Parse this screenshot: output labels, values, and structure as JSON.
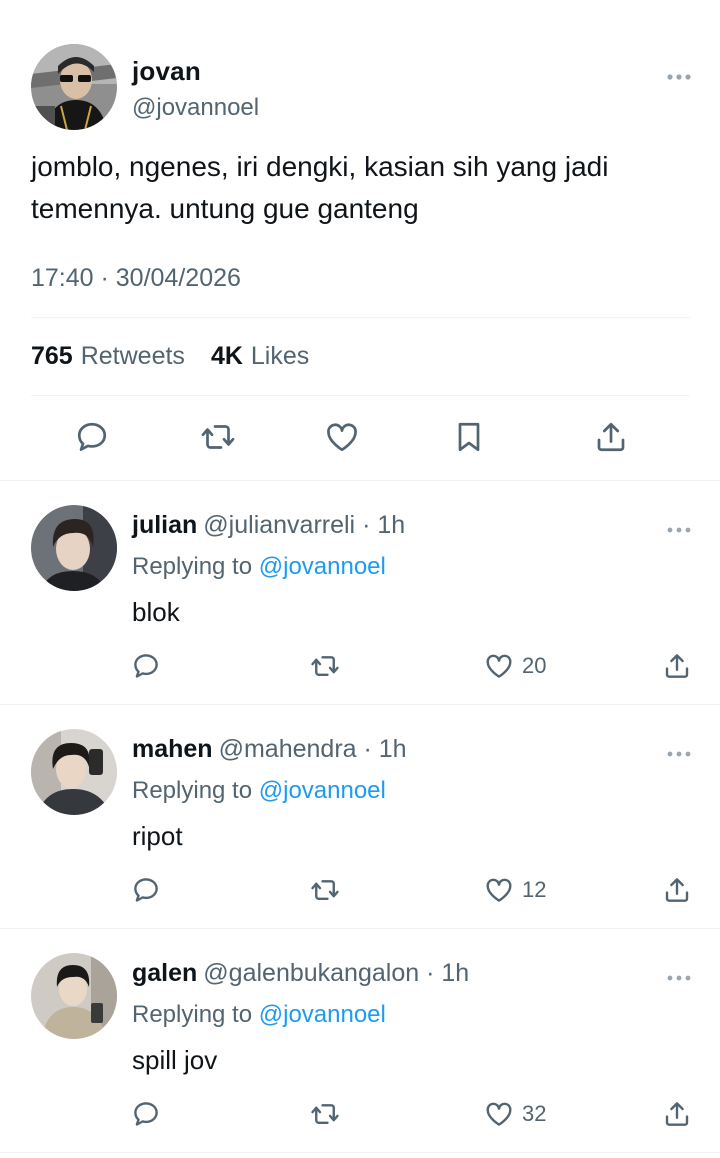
{
  "main_tweet": {
    "author_name": "jovan",
    "author_handle": "@jovannoel",
    "avatar_icon": "user-avatar-photo",
    "text": "jomblo, ngenes, iri dengki, kasian sih yang jadi temennya. untung gue ganteng",
    "timestamp": "17:40 · 30/04/2026",
    "retweets_count": "765",
    "retweets_label": "Retweets",
    "likes_count": "4K",
    "likes_label": "Likes",
    "actions": [
      "reply-icon",
      "retweet-icon",
      "like-icon",
      "bookmark-icon",
      "share-icon"
    ]
  },
  "replies": [
    {
      "name": "julian",
      "handle": "@julianvarreli",
      "time": "· 1h",
      "replying_prefix": "Replying to",
      "replying_to": "@jovannoel",
      "text": "blok",
      "likes": "20"
    },
    {
      "name": "mahen",
      "handle": "@mahendra",
      "time": "· 1h",
      "replying_prefix": "Replying to",
      "replying_to": "@jovannoel",
      "text": "ripot",
      "likes": "12"
    },
    {
      "name": "galen",
      "handle": "@galenbukangalon",
      "time": "· 1h",
      "replying_prefix": "Replying to",
      "replying_to": "@jovannoel",
      "text": "spill jov",
      "likes": "32"
    }
  ],
  "colors": {
    "text_primary": "#0f1419",
    "text_secondary": "#536471",
    "link": "#1d9bf0",
    "divider": "#eff3f4"
  }
}
